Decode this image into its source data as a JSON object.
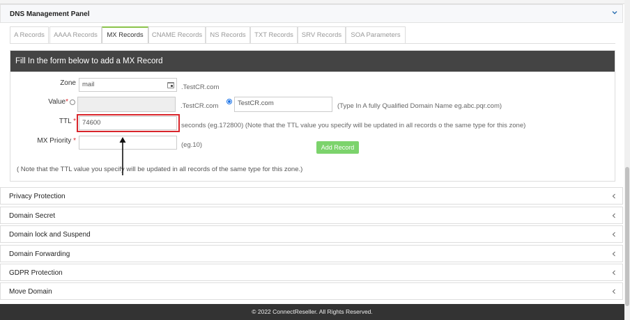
{
  "panel": {
    "title": "DNS Management Panel"
  },
  "tabs": [
    {
      "label": "A Records"
    },
    {
      "label": "AAAA Records"
    },
    {
      "label": "MX Records"
    },
    {
      "label": "CNAME Records"
    },
    {
      "label": "NS Records"
    },
    {
      "label": "TXT Records"
    },
    {
      "label": "SRV Records"
    },
    {
      "label": "SOA Parameters"
    }
  ],
  "active_tab": "MX Records",
  "form": {
    "heading": "Fill In the form below to add a MX Record",
    "zone": {
      "label": "Zone",
      "value": "mail",
      "suffix": ".TestCR.com"
    },
    "value": {
      "label": "Value",
      "value": "",
      "suffix": ".TestCR.com",
      "alt_value": "TestCR.com",
      "alt_hint": "(Type In A fully Qualified Domain Name eg.abc.pqr.com)"
    },
    "ttl": {
      "label": "TTL",
      "value": "74600",
      "hint": "seconds (eg.172800) (Note that the TTL value you specify will be updated in all records o the same type for this zone)"
    },
    "priority": {
      "label": "MX Priority",
      "value": "",
      "hint": "(eg.10)"
    },
    "required_mark": "*",
    "add_label": "Add Record",
    "note": "( Note that the TTL value you specify will be updated in all records of the same type for this zone.)"
  },
  "accordion": [
    {
      "label": "Privacy Protection"
    },
    {
      "label": "Domain Secret"
    },
    {
      "label": "Domain lock and Suspend"
    },
    {
      "label": "Domain Forwarding"
    },
    {
      "label": "GDPR Protection"
    },
    {
      "label": "Move Domain"
    }
  ],
  "footer": {
    "text": "© 2022 ConnectReseller. All Rights Reserved."
  },
  "colors": {
    "accent": "#8bc34a",
    "button": "#7cd36c",
    "header": "#444444",
    "highlight": "#d9252b",
    "footer": "#333333"
  }
}
